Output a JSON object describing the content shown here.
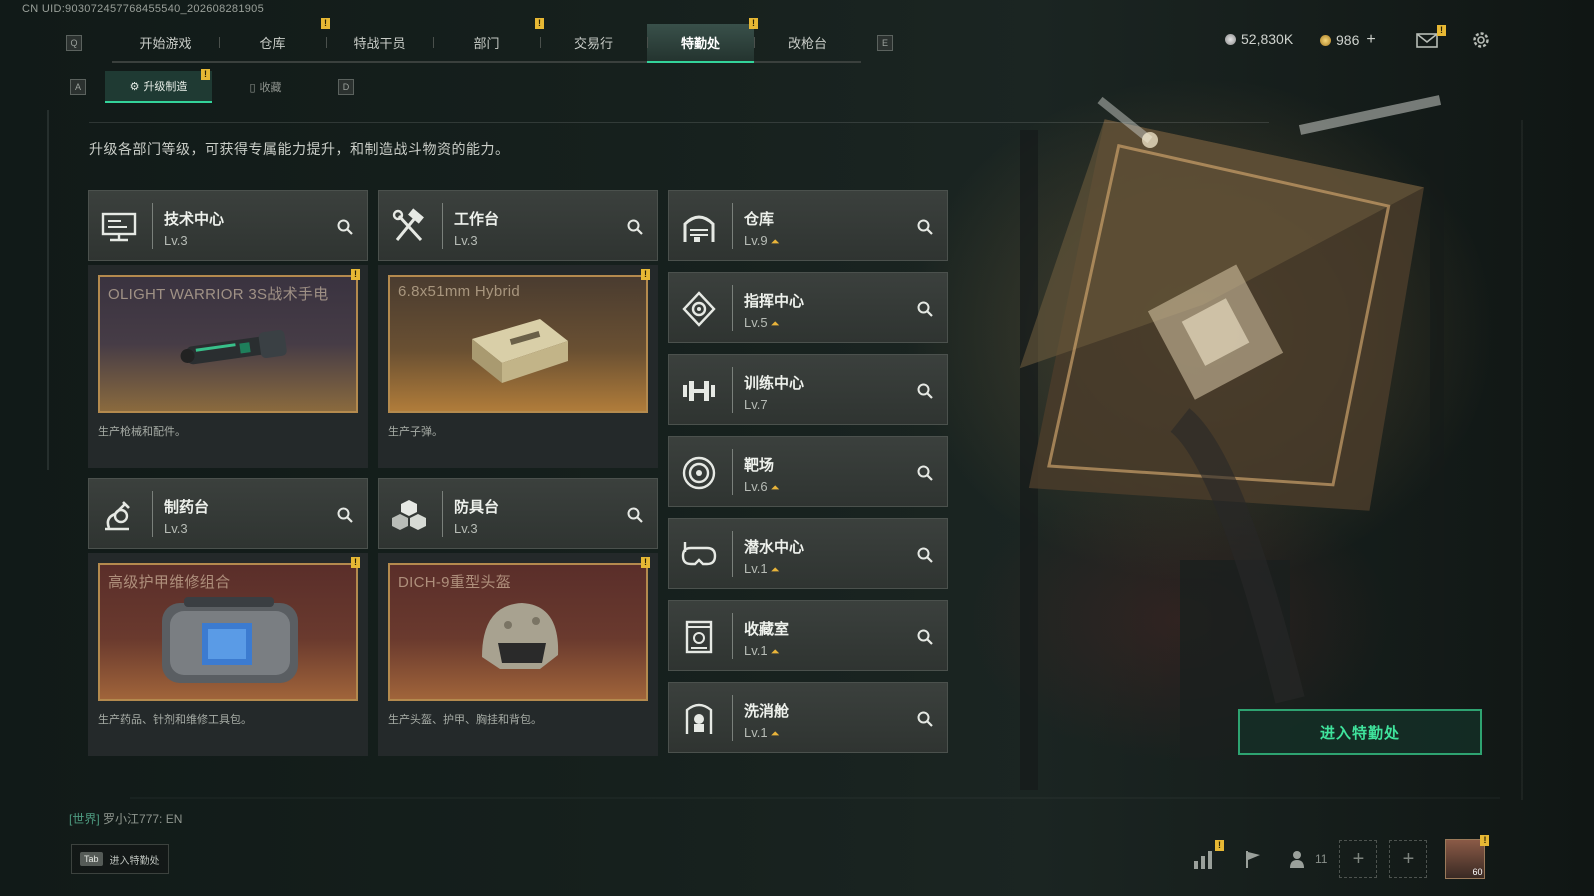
{
  "uid": "CN UID:903072457768455540_202608281905",
  "nav": {
    "left_key": "Q",
    "right_key": "E",
    "tabs": [
      {
        "label": "开始游戏",
        "badge": ""
      },
      {
        "label": "仓库",
        "badge": "!"
      },
      {
        "label": "特战干员",
        "badge": ""
      },
      {
        "label": "部门",
        "badge": "!"
      },
      {
        "label": "交易行",
        "badge": ""
      },
      {
        "label": "特勤处",
        "badge": "!"
      },
      {
        "label": "改枪台",
        "badge": ""
      }
    ],
    "active_index": 5
  },
  "currency": {
    "silver": "52,830K",
    "gold": "986",
    "gold_plus": "+"
  },
  "mail_badge": "!",
  "subnav": {
    "left_key": "A",
    "right_key": "D",
    "tabs": [
      {
        "label": "升级制造",
        "badge": "!"
      },
      {
        "label": "收藏",
        "badge": ""
      }
    ]
  },
  "description": "升级各部门等级，可获得专属能力提升，和制造战斗物资的能力。",
  "producers": [
    {
      "name": "技术中心",
      "level": "Lv.3",
      "item": "OLIGHT WARRIOR 3S战术手电",
      "desc": "生产枪械和配件。",
      "badge": "!",
      "icon": "computer-icon"
    },
    {
      "name": "工作台",
      "level": "Lv.3",
      "item": "6.8x51mm Hybrid",
      "desc": "生产子弹。",
      "badge": "!",
      "icon": "tools-icon"
    },
    {
      "name": "制药台",
      "level": "Lv.3",
      "item": "高级护甲维修组合",
      "desc": "生产药品、针剂和维修工具包。",
      "badge": "!",
      "icon": "flask-icon"
    },
    {
      "name": "防具台",
      "level": "Lv.3",
      "item": "DICH-9重型头盔",
      "desc": "生产头盔、护甲、胸挂和背包。",
      "badge": "!",
      "icon": "cubes-icon"
    }
  ],
  "departments": [
    {
      "name": "仓库",
      "level": "Lv.9",
      "upgrade": true,
      "icon": "warehouse-icon"
    },
    {
      "name": "指挥中心",
      "level": "Lv.5",
      "upgrade": true,
      "icon": "command-icon"
    },
    {
      "name": "训练中心",
      "level": "Lv.7",
      "upgrade": false,
      "icon": "dumbbell-icon"
    },
    {
      "name": "靶场",
      "level": "Lv.6",
      "upgrade": true,
      "icon": "target-icon"
    },
    {
      "name": "潜水中心",
      "level": "Lv.1",
      "upgrade": true,
      "icon": "goggles-icon"
    },
    {
      "name": "收藏室",
      "level": "Lv.1",
      "upgrade": true,
      "icon": "collection-icon"
    },
    {
      "name": "洗消舱",
      "level": "Lv.1",
      "upgrade": true,
      "icon": "decontam-icon"
    }
  ],
  "enter_button": "进入特勤处",
  "chat": {
    "channel": "[世界]",
    "message": "罗小江777: EN"
  },
  "tab_hint": {
    "key": "Tab",
    "label": "进入特勤处"
  },
  "bottom": {
    "friends_count": "11",
    "avatar_level": "60",
    "stats_badge": "!",
    "avatar_badge": "!"
  }
}
